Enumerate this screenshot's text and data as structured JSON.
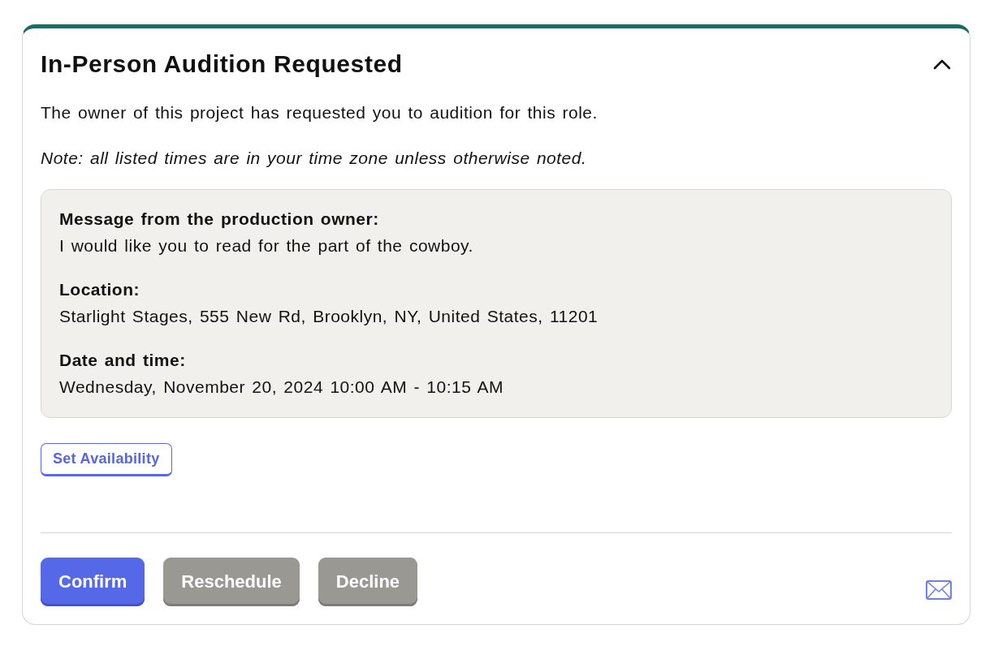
{
  "card": {
    "title": "In-Person Audition Requested",
    "expanded": true,
    "intro": "The owner of this project has requested you to audition for this role.",
    "note": "Note: all listed times are in your time zone unless otherwise noted.",
    "details": [
      {
        "label": "Message from the production owner:",
        "value": "I would like you to read for the part of the cowboy."
      },
      {
        "label": "Location:",
        "value": "Starlight Stages, 555 New Rd, Brooklyn, NY, United States, 11201"
      },
      {
        "label": "Date and time:",
        "value": "Wednesday, November 20, 2024 10:00 AM - 10:15 AM"
      }
    ],
    "availability_button": "Set Availability",
    "actions": [
      {
        "label": "Confirm",
        "kind": "primary"
      },
      {
        "label": "Reschedule",
        "kind": "muted"
      },
      {
        "label": "Decline",
        "kind": "muted"
      }
    ]
  }
}
